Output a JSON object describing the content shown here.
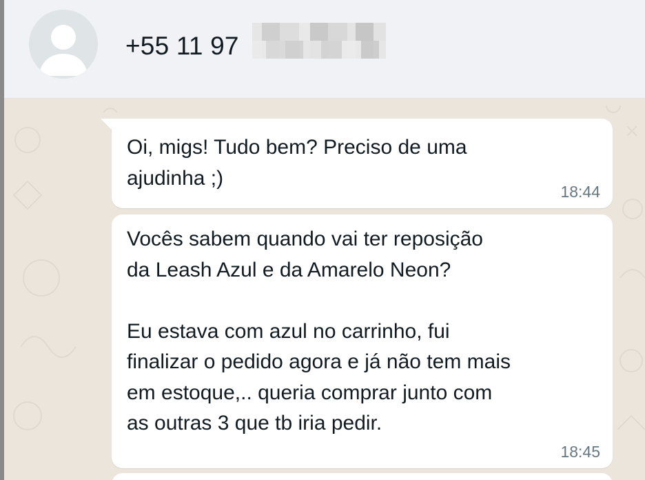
{
  "header": {
    "contact_name": "+55 11 97"
  },
  "messages": [
    {
      "text": "Oi, migs! Tudo bem? Preciso de uma\najudinha ;)",
      "time": "18:44"
    },
    {
      "text": "Vocês sabem quando vai ter reposição\nda Leash Azul e da Amarelo Neon?\n\nEu estava com azul no carrinho, fui\nfinalizar o pedido agora e já não tem mais\nem estoque,.. queria comprar junto com\nas outras 3 que tb iria pedir.",
      "time": "18:45"
    }
  ],
  "colors": {
    "header_bg": "#f0f2f5",
    "chat_bg": "#ece5dc",
    "bubble_bg": "#ffffff",
    "time_text": "#667781"
  }
}
